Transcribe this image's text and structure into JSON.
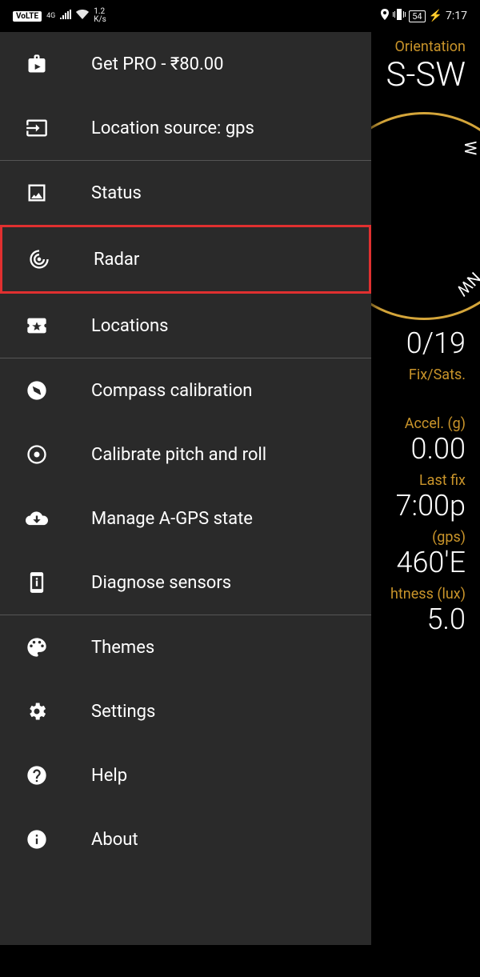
{
  "status_bar": {
    "volte": "VoLTE",
    "network": "4G",
    "speed": "1.2",
    "speed_unit": "K/s",
    "battery": "54",
    "time": "7:17"
  },
  "background": {
    "orientation_label": "Orientation",
    "orientation_value": "S-SW",
    "fix_sats_value": "0/19",
    "fix_sats_label": "Fix/Sats.",
    "accel_label": "Accel. (g)",
    "accel_value": "0.00",
    "lastfix_label": "Last fix",
    "lastfix_value": "7:00p",
    "gps_label": "(gps)",
    "gps_value": "460'E",
    "brightness_label": "htness (lux)",
    "brightness_value": "5.0",
    "compass_w1": "W",
    "compass_w2": "NW"
  },
  "drawer": {
    "get_pro": "Get PRO - ₹80.00",
    "location_source": "Location source: gps",
    "status": "Status",
    "radar": "Radar",
    "locations": "Locations",
    "compass_calibration": "Compass calibration",
    "calibrate_pitch": "Calibrate pitch and roll",
    "manage_agps": "Manage A-GPS state",
    "diagnose_sensors": "Diagnose sensors",
    "themes": "Themes",
    "settings": "Settings",
    "help": "Help",
    "about": "About"
  }
}
